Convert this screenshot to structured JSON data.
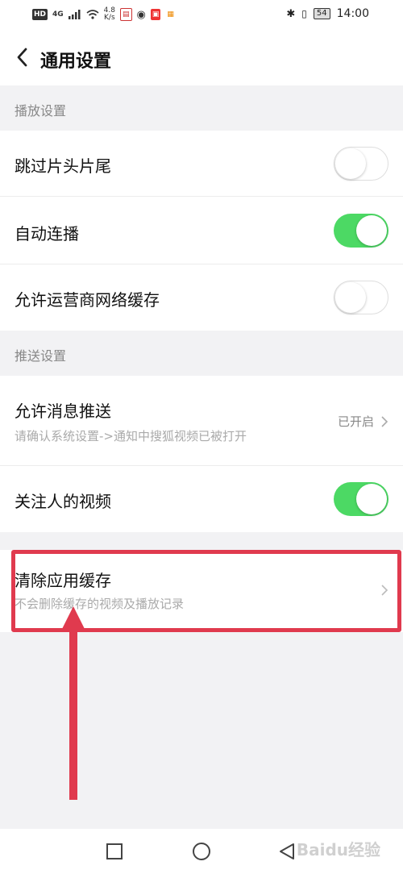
{
  "status_bar": {
    "network": "HD",
    "signal_gen": "4G",
    "speed_value": "4.8",
    "speed_unit": "K/s",
    "time": "14:00",
    "battery": "54"
  },
  "header": {
    "title": "通用设置"
  },
  "sections": [
    {
      "title": "播放设置",
      "items": [
        {
          "label": "跳过片头片尾",
          "toggle": "off"
        },
        {
          "label": "自动连播",
          "toggle": "on"
        },
        {
          "label": "允许运营商网络缓存",
          "toggle": "off"
        }
      ]
    },
    {
      "title": "推送设置",
      "items": [
        {
          "label": "允许消息推送",
          "subtitle": "请确认系统设置->通知中搜狐视频已被打开",
          "value": "已开启"
        },
        {
          "label": "关注人的视频",
          "toggle": "on"
        }
      ]
    }
  ],
  "clear_cache": {
    "label": "清除应用缓存",
    "subtitle": "不会删除缓存的视频及播放记录"
  },
  "watermark": "Baidu经验",
  "colors": {
    "toggle_on": "#4cd964",
    "highlight": "#e03a4e",
    "background": "#f2f2f4"
  }
}
